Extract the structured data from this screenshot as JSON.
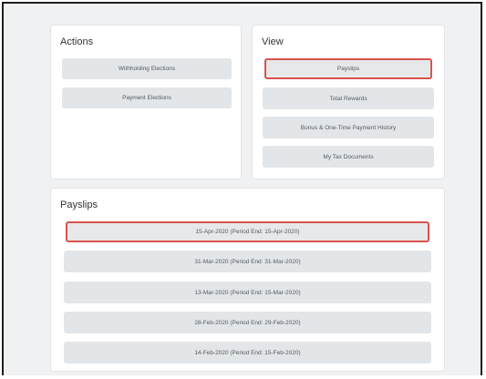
{
  "actions": {
    "title": "Actions",
    "buttons": [
      "Withholding Elections",
      "Payment Elections"
    ]
  },
  "view": {
    "title": "View",
    "buttons": [
      "Payslips",
      "Total Rewards",
      "Bonus & One-Time Payment History",
      "My Tax Documents"
    ]
  },
  "payslips": {
    "title": "Payslips",
    "items": [
      "15-Apr-2020 (Period End: 15-Apr-2020)",
      "31-Mar-2020 (Period End: 31-Mar-2020)",
      "13-Mar-2020 (Period End: 15-Mar-2020)",
      "28-Feb-2020 (Period End: 29-Feb-2020)",
      "14-Feb-2020 (Period End: 15-Feb-2020)"
    ]
  },
  "colors": {
    "highlight": "#d9534f",
    "button_bg": "#e3e6e8",
    "page_bg": "#f0f1f2"
  }
}
